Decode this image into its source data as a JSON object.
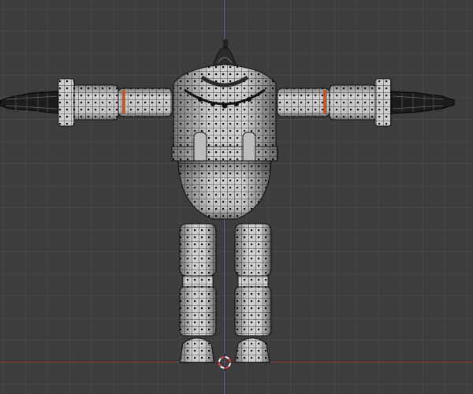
{
  "viewport": {
    "view": "front-orthographic",
    "background_color": "#3d3d3d",
    "grid_color": "#474747",
    "x_axis_color": "#8a3c3c",
    "z_axis_color": "#5560a8",
    "grid_visible": true
  },
  "model": {
    "type": "robot-mesh",
    "display": "wireframe-over-solid",
    "mesh_color": "#cfcfcf",
    "wire_color": "#1a1a1a",
    "selected_edge_color": "#c05a28",
    "parts": [
      "head-antenna",
      "torso",
      "belt",
      "left-arm",
      "right-arm",
      "left-hand",
      "right-hand",
      "left-leg",
      "right-leg",
      "left-foot",
      "right-foot"
    ]
  },
  "cursor_3d": {
    "icon": "3d-cursor-icon",
    "ring_color_a": "#e04040",
    "ring_color_b": "#ffffff"
  }
}
